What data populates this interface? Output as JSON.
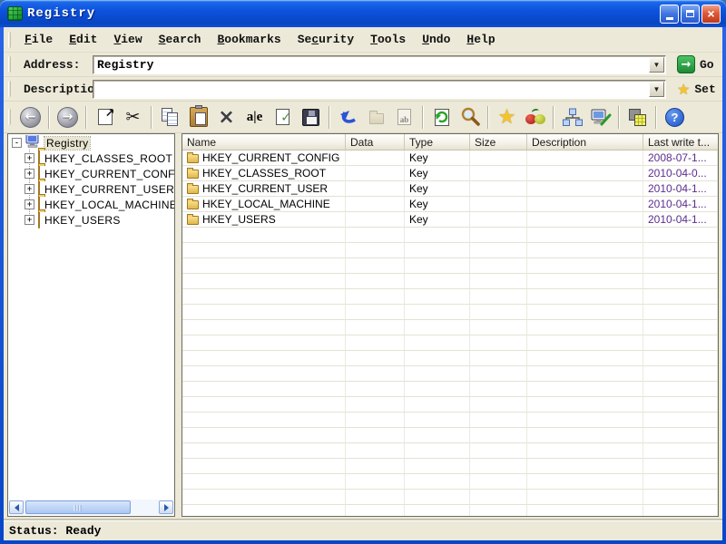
{
  "window": {
    "title": "Registry"
  },
  "icons": {
    "close": "×",
    "back": "←",
    "forward": "→",
    "export": "↗",
    "cut": "✂",
    "delete": "×",
    "rename_glyph": "a|e",
    "check": "✓",
    "newvalue_glyph": "ab",
    "star": "★",
    "help": "?",
    "go_arrow": "→",
    "dropdown": "▼",
    "tree_minus": "-",
    "tree_plus": "+"
  },
  "menu": {
    "items": [
      {
        "pre": "",
        "key": "F",
        "post": "ile"
      },
      {
        "pre": "",
        "key": "E",
        "post": "dit"
      },
      {
        "pre": "",
        "key": "V",
        "post": "iew"
      },
      {
        "pre": "",
        "key": "S",
        "post": "earch"
      },
      {
        "pre": "",
        "key": "B",
        "post": "ookmarks"
      },
      {
        "pre": "Se",
        "key": "c",
        "post": "urity"
      },
      {
        "pre": "",
        "key": "T",
        "post": "ools"
      },
      {
        "pre": "",
        "key": "U",
        "post": "ndo"
      },
      {
        "pre": "",
        "key": "H",
        "post": "elp"
      }
    ]
  },
  "address_bar": {
    "label": "Address:",
    "value": "Registry",
    "go_label": "Go"
  },
  "description_bar": {
    "label": "Description",
    "value": "",
    "set_label": "Set"
  },
  "tree": {
    "root_label": "Registry",
    "nodes": [
      "HKEY_CLASSES_ROOT",
      "HKEY_CURRENT_CONFIG",
      "HKEY_CURRENT_USER",
      "HKEY_LOCAL_MACHINE",
      "HKEY_USERS"
    ]
  },
  "list": {
    "columns": [
      "Name",
      "Data",
      "Type",
      "Size",
      "Description",
      "Last write t..."
    ],
    "rows": [
      {
        "name": "HKEY_CURRENT_CONFIG",
        "data": "",
        "type": "Key",
        "size": "",
        "description": "",
        "last_write": "2008-07-1..."
      },
      {
        "name": "HKEY_CLASSES_ROOT",
        "data": "",
        "type": "Key",
        "size": "",
        "description": "",
        "last_write": "2010-04-0..."
      },
      {
        "name": "HKEY_CURRENT_USER",
        "data": "",
        "type": "Key",
        "size": "",
        "description": "",
        "last_write": "2010-04-1..."
      },
      {
        "name": "HKEY_LOCAL_MACHINE",
        "data": "",
        "type": "Key",
        "size": "",
        "description": "",
        "last_write": "2010-04-1..."
      },
      {
        "name": "HKEY_USERS",
        "data": "",
        "type": "Key",
        "size": "",
        "description": "",
        "last_write": "2010-04-1..."
      }
    ]
  },
  "status_bar": {
    "text": "Status: Ready"
  },
  "colors": {
    "title_blue": "#0c52dc",
    "window_border": "#0a54e0",
    "chrome": "#ece9d8",
    "go_green": "#22a03c",
    "star_gold": "#f4c430",
    "date_purple": "#5b2d8e"
  }
}
